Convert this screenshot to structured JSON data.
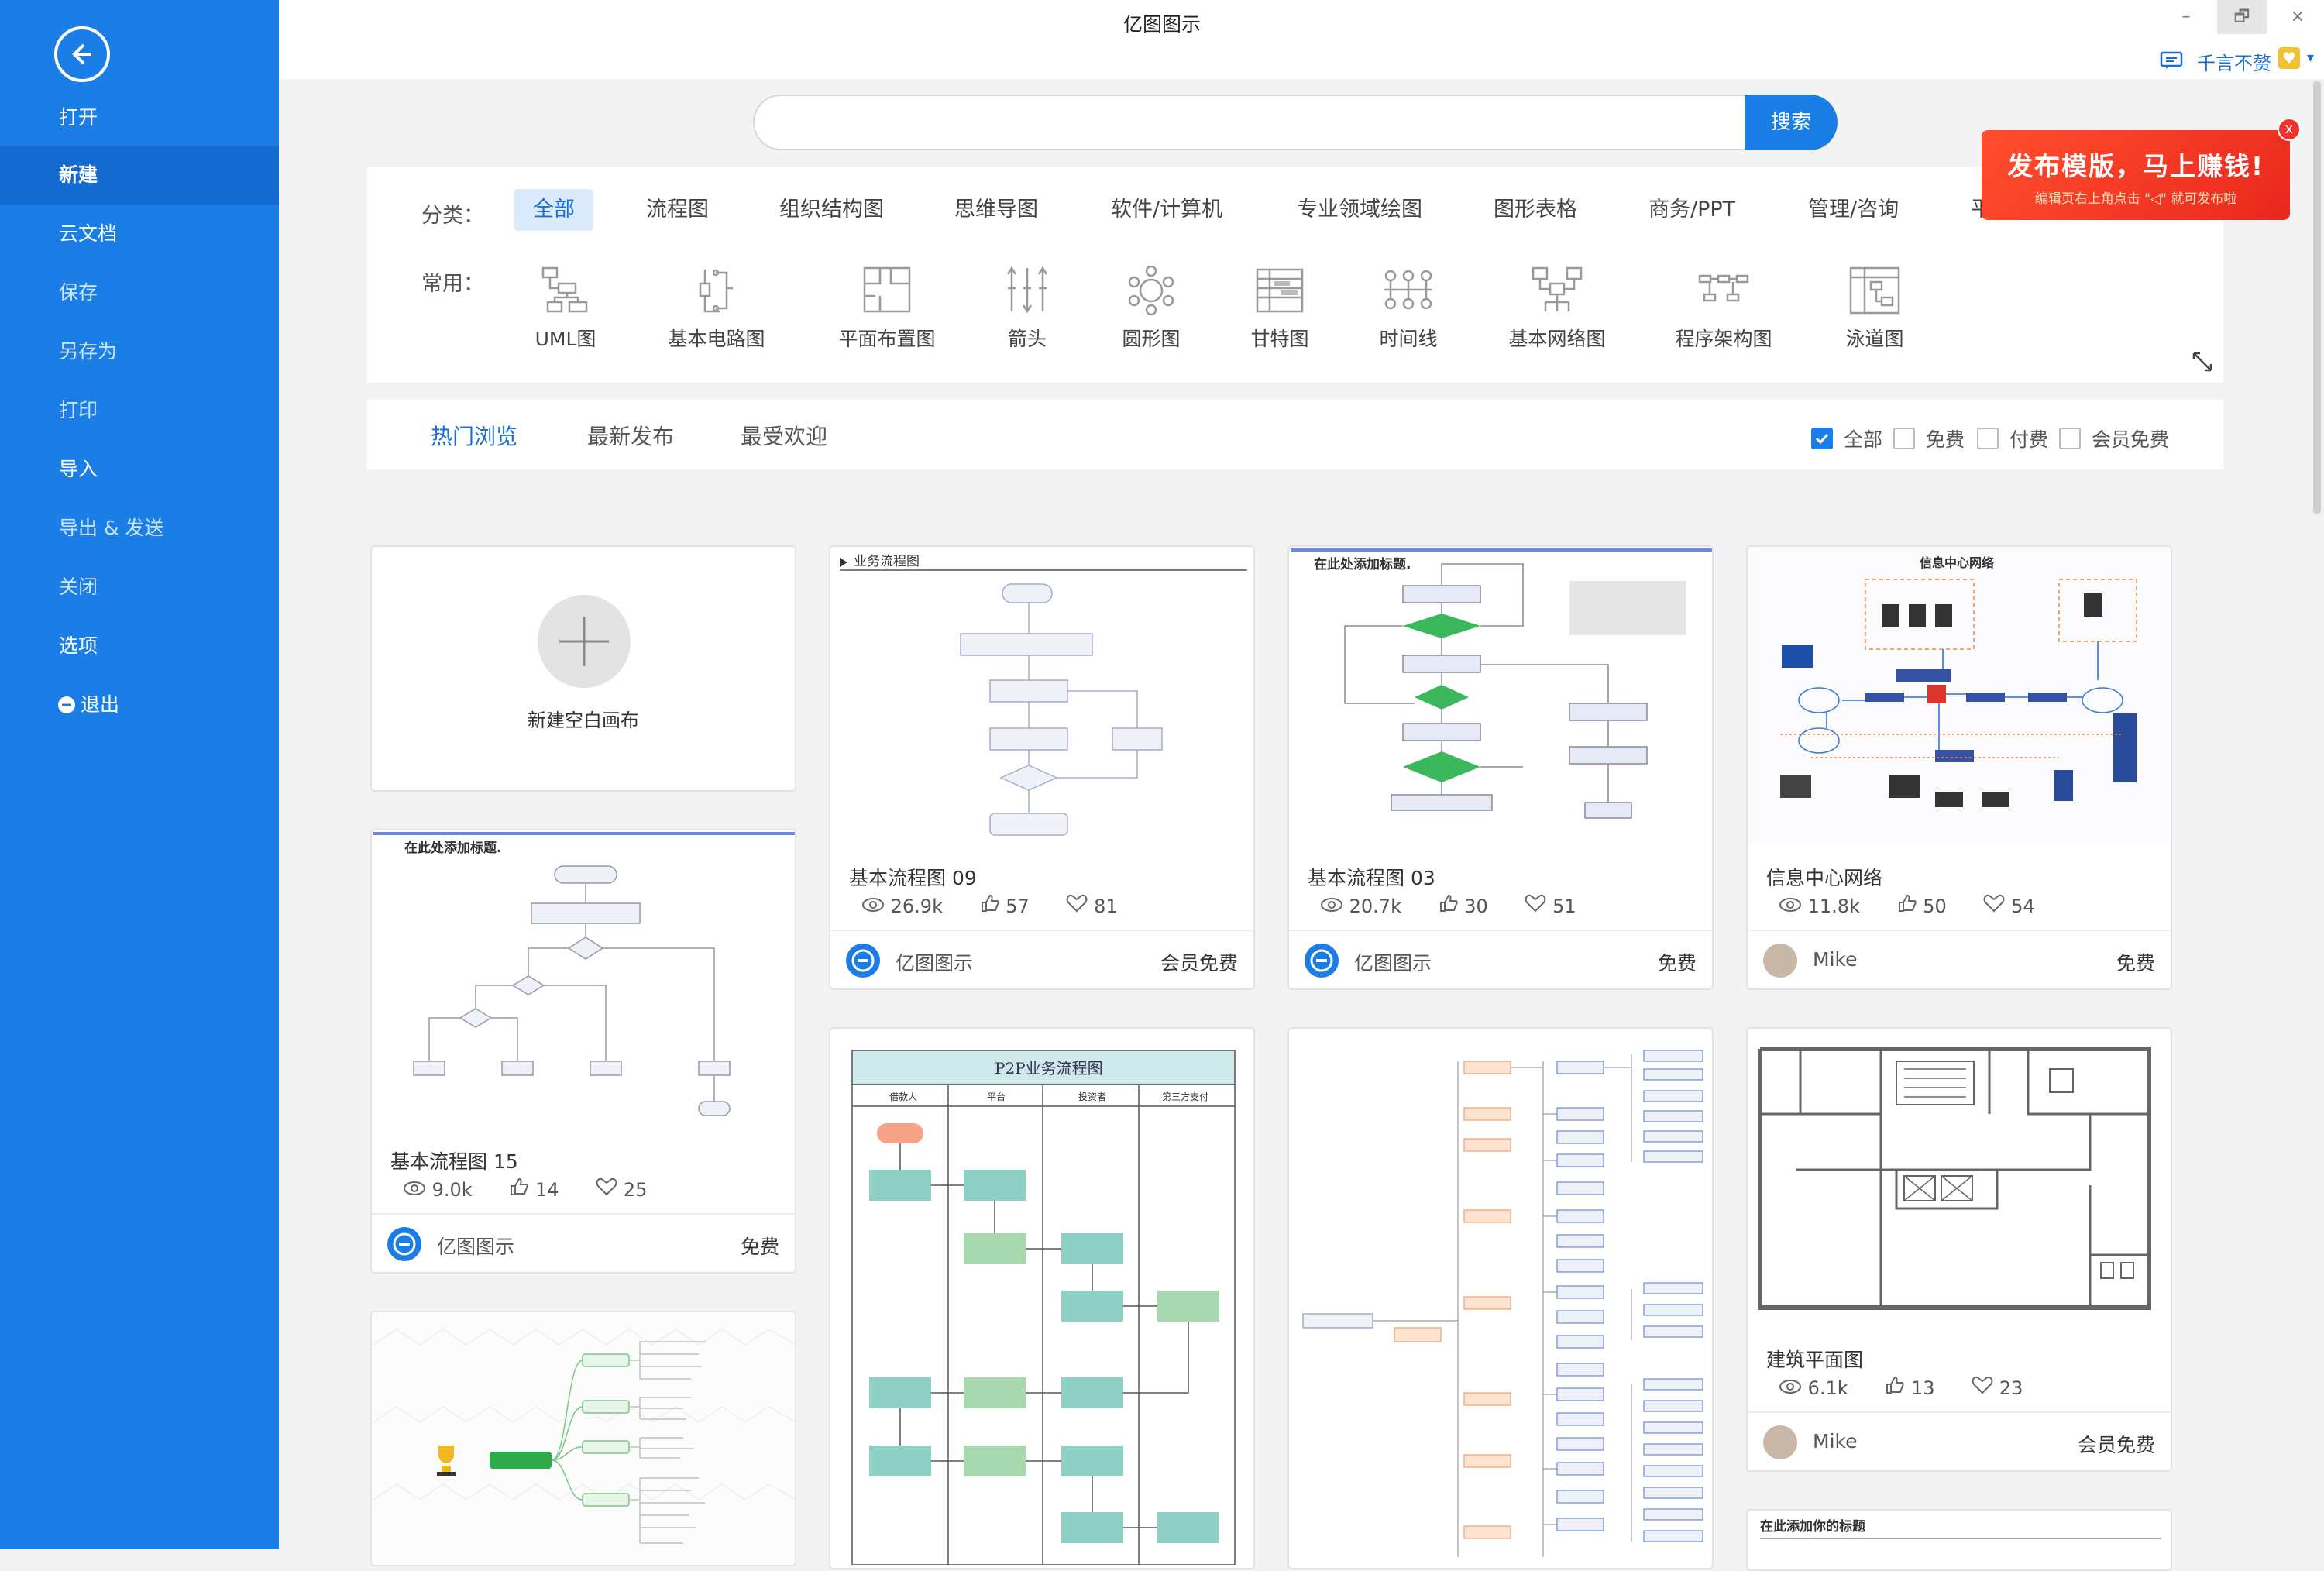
{
  "window": {
    "title": "亿图图示",
    "minimize": "–",
    "restore": "🗗",
    "close": "×"
  },
  "user": {
    "name": "千言不赘"
  },
  "sidebar": {
    "items": [
      "打开",
      "新建",
      "云文档",
      "保存",
      "另存为",
      "打印",
      "导入",
      "导出 & 发送",
      "关闭",
      "选项",
      "退出"
    ]
  },
  "search": {
    "placeholder": "",
    "button": "搜索"
  },
  "categories": {
    "label": "分类：",
    "items": [
      "全部",
      "流程图",
      "组织结构图",
      "思维导图",
      "软件/计算机",
      "专业领域绘图",
      "图形表格",
      "商务/PPT",
      "管理/咨询",
      "平"
    ]
  },
  "common": {
    "label": "常用：",
    "items": [
      "UML图",
      "基本电路图",
      "平面布置图",
      "箭头",
      "圆形图",
      "甘特图",
      "时间线",
      "基本网络图",
      "程序架构图",
      "泳道图"
    ]
  },
  "promo": {
    "title": "发布模版，马上赚钱!",
    "subtitle": "编辑页右上角点击 \"◁\" 就可发布啦",
    "close": "x"
  },
  "tabs": [
    "热门浏览",
    "最新发布",
    "最受欢迎"
  ],
  "filters": [
    "全部",
    "免费",
    "付费",
    "会员免费"
  ],
  "new_canvas": "新建空白画布",
  "thumb_titles": {
    "t09": "业务流程图",
    "t03": "在此处添加标题.",
    "net": "信息中心网络",
    "t15": "在此处添加标题.",
    "p2p": "P2P业务流程图",
    "p2p_cols": [
      "借款人",
      "平台",
      "投资者",
      "第三方支付"
    ],
    "last": "在此添加你的标题"
  },
  "cards": [
    {
      "title": "基本流程图 09",
      "views": "26.9k",
      "likes": "57",
      "favs": "81",
      "author": "亿图图示",
      "price": "会员免费"
    },
    {
      "title": "基本流程图 03",
      "views": "20.7k",
      "likes": "30",
      "favs": "51",
      "author": "亿图图示",
      "price": "免费"
    },
    {
      "title": "信息中心网络",
      "views": "11.8k",
      "likes": "50",
      "favs": "54",
      "author": "Mike",
      "price": "免费"
    },
    {
      "title": "基本流程图 15",
      "views": "9.0k",
      "likes": "14",
      "favs": "25",
      "author": "亿图图示",
      "price": "免费"
    },
    {
      "title": "建筑平面图",
      "views": "6.1k",
      "likes": "13",
      "favs": "23",
      "author": "Mike",
      "price": "会员免费"
    }
  ],
  "colors": {
    "brand": "#1a7ee6",
    "sidebar_active": "#156cd0",
    "promo": "#e9271d"
  }
}
